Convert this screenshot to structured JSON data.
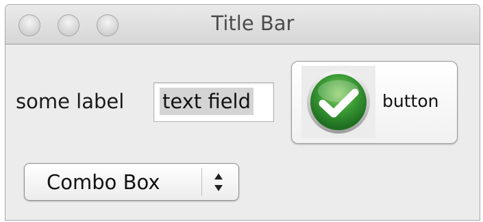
{
  "window": {
    "title": "Title Bar"
  },
  "titlebar_buttons": [
    {
      "name": "close",
      "icon": "circle-icon"
    },
    {
      "name": "minimize",
      "icon": "circle-icon"
    },
    {
      "name": "zoom",
      "icon": "circle-icon"
    }
  ],
  "form": {
    "label": "some label",
    "text_field_value": "text field",
    "button_label": "button",
    "button_icon": "checkmark-icon",
    "combo_value": "Combo Box"
  },
  "colors": {
    "check_green": "#2e8a2e",
    "check_green_light": "#7cc05a"
  }
}
